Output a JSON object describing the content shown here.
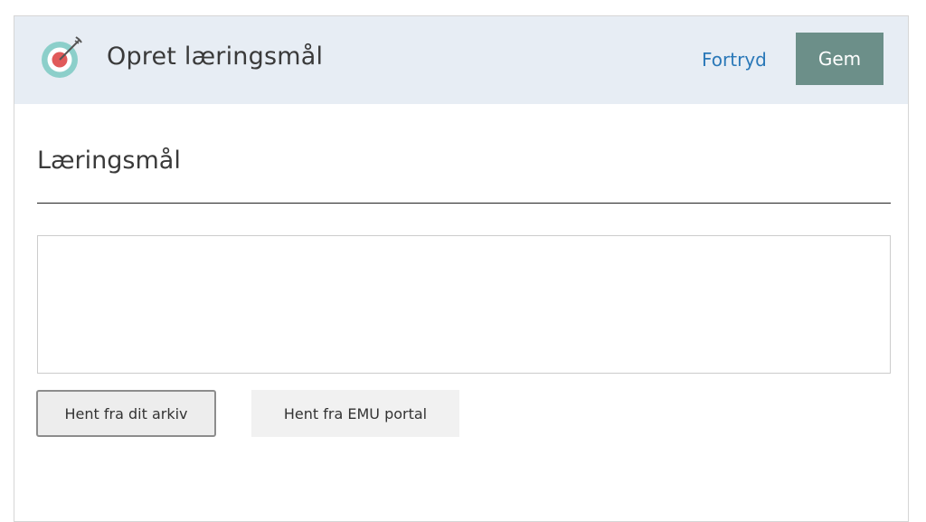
{
  "header": {
    "title": "Opret læringsmål",
    "cancel_label": "Fortryd",
    "save_label": "Gem",
    "logo_icon": "target-arrow-icon"
  },
  "form": {
    "section_heading": "Læringsmål",
    "textarea_value": "",
    "archive_button_label": "Hent fra dit arkiv",
    "emu_button_label": "Hent fra EMU portal"
  },
  "colors": {
    "header_bg": "#e7edf4",
    "save_button_bg": "#6c8f89",
    "link": "#2a78b8",
    "target_ring": "#8ccfca",
    "target_center": "#e05a5a"
  }
}
